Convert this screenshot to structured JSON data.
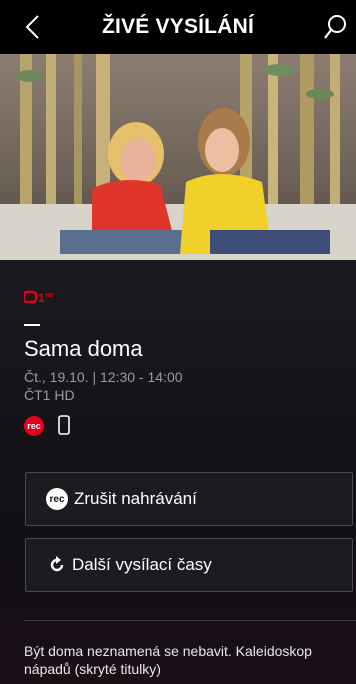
{
  "header": {
    "title": "ŽIVÉ VYSÍLÁNÍ",
    "back_icon": "back-chevron-icon",
    "search_icon": "search-icon"
  },
  "program": {
    "channel_logo_text": "1",
    "channel_logo_sup": "HD",
    "title": "Sama doma",
    "datetime": "Čt., 19.10. | 12:30 - 14:00",
    "channel": "ČT1 HD",
    "rec_badge": "rec"
  },
  "buttons": {
    "cancel_recording": {
      "icon_text": "rec",
      "label": "Zrušit nahrávání"
    },
    "more_times": {
      "label": "Další vysílací časy"
    }
  },
  "description": "Být doma neznamená se nebavit. Kaleidoskop nápadů (skryté titulky)",
  "colors": {
    "accent_red": "#e4001b",
    "background": "#0d0b10",
    "header": "#000000"
  }
}
